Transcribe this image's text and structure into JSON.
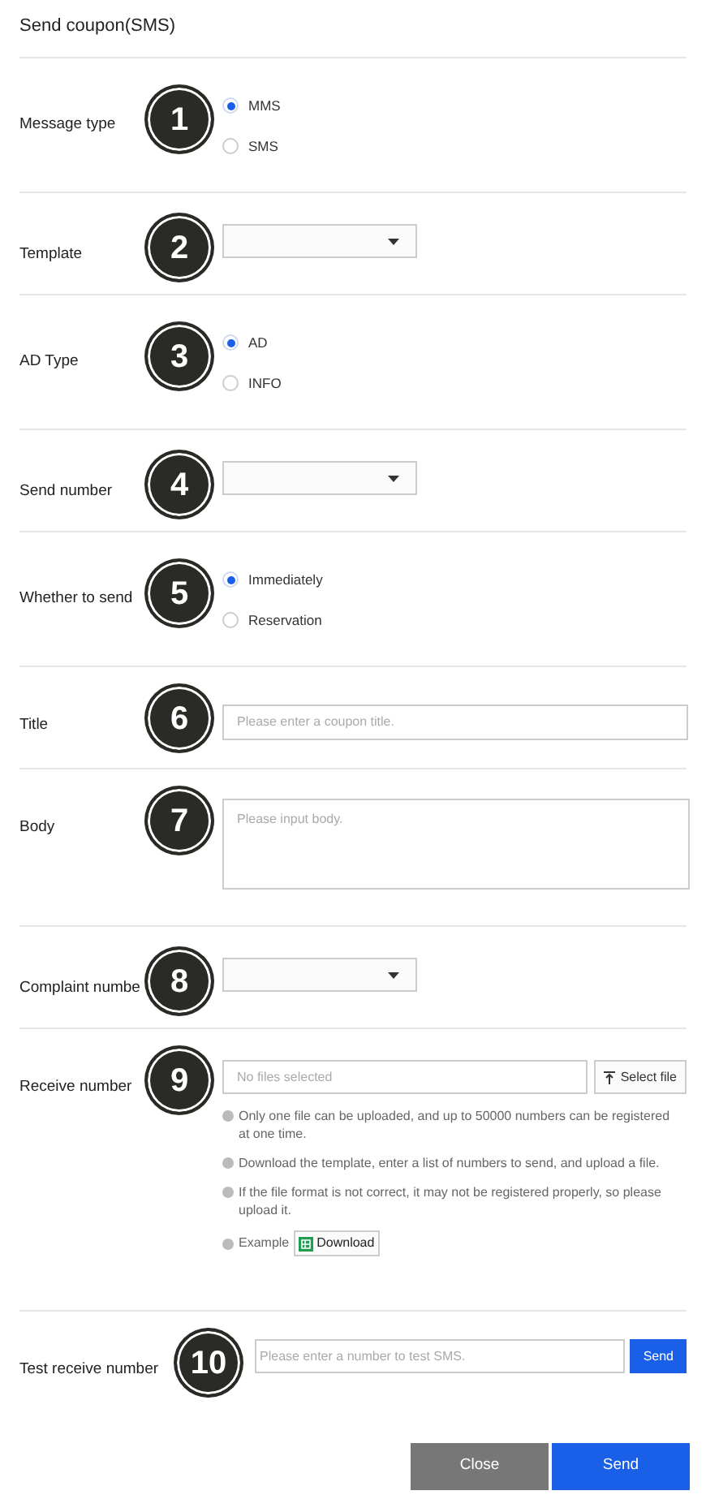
{
  "title": "Send coupon(SMS)",
  "rows": [
    {
      "kind": "radio",
      "label": "Message type",
      "badge": "1",
      "options": [
        {
          "label": "MMS",
          "selected": true
        },
        {
          "label": "SMS",
          "selected": false
        }
      ]
    },
    {
      "kind": "select",
      "label": "Template",
      "badge": "2"
    },
    {
      "kind": "radio",
      "label": "AD Type",
      "badge": "3",
      "options": [
        {
          "label": "AD",
          "selected": true
        },
        {
          "label": "INFO",
          "selected": false
        }
      ]
    },
    {
      "kind": "select",
      "label": "Send number",
      "badge": "4"
    },
    {
      "kind": "radio",
      "label": "Whether to send",
      "badge": "5",
      "options": [
        {
          "label": "Immediately",
          "selected": true
        },
        {
          "label": "Reservation",
          "selected": false
        }
      ]
    },
    {
      "kind": "input",
      "label": "Title",
      "badge": "6",
      "placeholder": "Please enter a coupon title."
    },
    {
      "kind": "textarea",
      "label": "Body",
      "badge": "7",
      "placeholder": "Please input body."
    },
    {
      "kind": "select",
      "label": "Complaint numbe",
      "badge": "8"
    },
    {
      "kind": "file",
      "label": "Receive number",
      "badge": "9",
      "placeholder": "No files selected",
      "button": "Select file",
      "notes": [
        "Only one file can be uploaded, and up to 50000 numbers can be registered at one time.",
        "Download the template, enter a list of numbers to send, and upload a file.",
        "If the file format is not correct, it may not be registered properly, so please upload it."
      ],
      "example_label": "Example",
      "download": "Download"
    },
    {
      "kind": "test",
      "label": "Test receive number",
      "badge": "10",
      "placeholder": "Please enter a number to test SMS.",
      "button": "Send"
    }
  ],
  "buttons": [
    {
      "label": "Close",
      "kind": "secondary"
    },
    {
      "label": "Send",
      "kind": "primary"
    }
  ]
}
